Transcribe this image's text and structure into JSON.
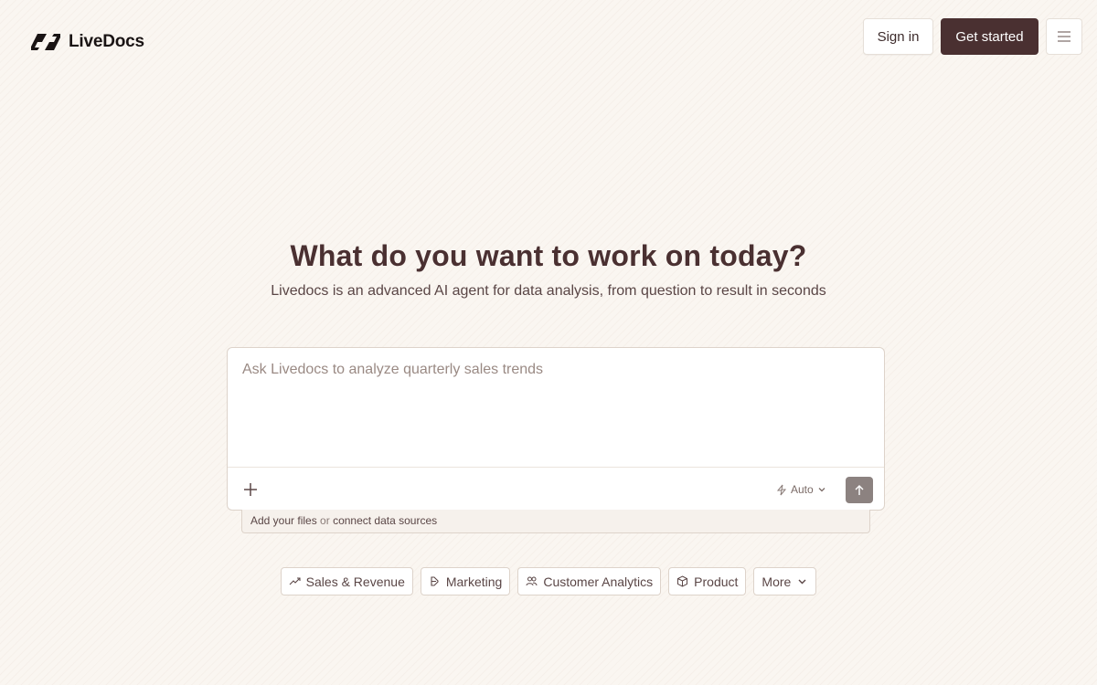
{
  "header": {
    "brand": "LiveDocs",
    "sign_in": "Sign in",
    "get_started": "Get started",
    "menu_icon": "hamburger-icon"
  },
  "hero": {
    "title": "What do you want to work on today?",
    "subtitle": "Livedocs is an advanced AI agent for data analysis, from question to result in seconds"
  },
  "prompt": {
    "placeholder": "Ask Livedocs to analyze quarterly sales trends",
    "value": "",
    "mode": "Auto",
    "add_icon": "plus-icon",
    "send_icon": "arrow-up-icon"
  },
  "files_bar": {
    "add_files": "Add your files",
    "or": "or",
    "connect": "connect data sources"
  },
  "chips": [
    {
      "label": "Sales & Revenue",
      "icon": "trending-up-icon"
    },
    {
      "label": "Marketing",
      "icon": "megaphone-icon"
    },
    {
      "label": "Customer Analytics",
      "icon": "users-icon"
    },
    {
      "label": "Product",
      "icon": "box-icon"
    },
    {
      "label": "More",
      "icon": "chevron-down-icon"
    }
  ],
  "colors": {
    "background": "#faf6f1",
    "primary": "#4a3031",
    "text": "#3d2b2b",
    "muted": "#9a8a84",
    "border": "#ddd3ca",
    "send_button": "#8c8280"
  }
}
